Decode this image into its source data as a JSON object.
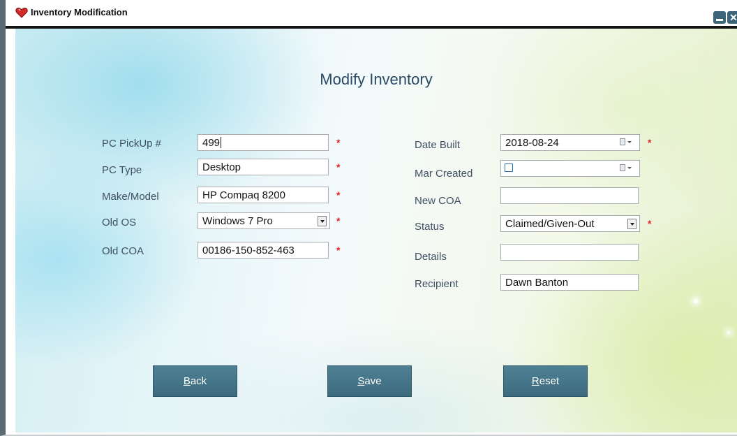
{
  "window": {
    "title": "Inventory Modification",
    "close_label": "✕"
  },
  "form": {
    "heading": "Modify Inventory",
    "left": {
      "pickup": {
        "label": "PC PickUp #",
        "value": "499"
      },
      "type": {
        "label": "PC Type",
        "value": "Desktop"
      },
      "model": {
        "label": "Make/Model",
        "value": "HP Compaq 8200"
      },
      "old_os": {
        "label": "Old OS",
        "value": "Windows 7 Pro"
      },
      "old_coa": {
        "label": "Old COA",
        "value": "00186-150-852-463"
      }
    },
    "right": {
      "date_built": {
        "label": "Date Built",
        "value": "2018-08-24"
      },
      "mar_created": {
        "label": "Mar Created",
        "value": ""
      },
      "new_coa": {
        "label": "New COA",
        "value": ""
      },
      "status": {
        "label": "Status",
        "value": "Claimed/Given-Out"
      },
      "details": {
        "label": "Details",
        "value": ""
      },
      "recipient": {
        "label": "Recipient",
        "value": "Dawn Banton"
      }
    },
    "required_marker": "*"
  },
  "buttons": {
    "back": {
      "accel": "B",
      "rest": "ack"
    },
    "save": {
      "accel": "S",
      "rest": "ave"
    },
    "reset": {
      "accel": "R",
      "rest": "eset"
    }
  },
  "icons": {
    "app": "red-heart-icon",
    "minimize": "minimize-icon",
    "close": "close-icon",
    "calendar": "calendar-dropdown-icon",
    "dropdown": "chevron-down-icon"
  },
  "colors": {
    "button": "#3d6b7e",
    "required": "#e0242a",
    "heading": "#2a4a66"
  }
}
